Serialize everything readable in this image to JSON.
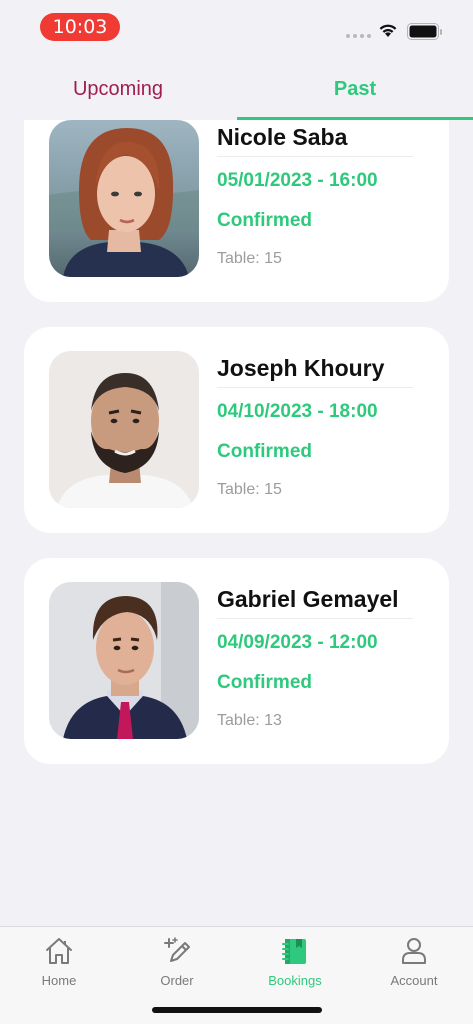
{
  "status_bar": {
    "time": "10:03"
  },
  "tabs": {
    "upcoming": "Upcoming",
    "past": "Past",
    "active": "past"
  },
  "bookings": [
    {
      "name": "Nicole Saba",
      "datetime": "05/01/2023 - 16:00",
      "status": "Confirmed",
      "table": "Table: 15"
    },
    {
      "name": "Joseph Khoury",
      "datetime": "04/10/2023 - 18:00",
      "status": "Confirmed",
      "table": "Table: 15"
    },
    {
      "name": "Gabriel Gemayel",
      "datetime": "04/09/2023 - 12:00",
      "status": "Confirmed",
      "table": "Table: 13"
    }
  ],
  "bottom_nav": {
    "items": [
      {
        "label": "Home",
        "icon": "home-icon"
      },
      {
        "label": "Order",
        "icon": "pencil-icon"
      },
      {
        "label": "Bookings",
        "icon": "notebook-icon"
      },
      {
        "label": "Account",
        "icon": "person-icon"
      }
    ],
    "active": "Bookings"
  },
  "colors": {
    "accent": "#2ec97c",
    "upcoming_tab": "#a01e4e",
    "time_pill": "#ef3b34"
  }
}
